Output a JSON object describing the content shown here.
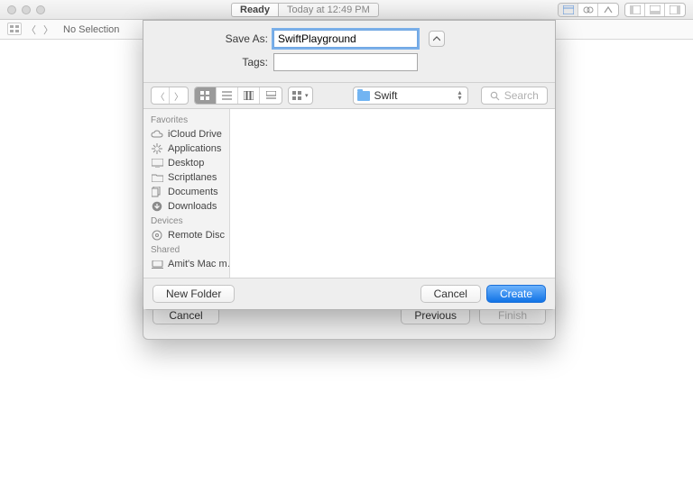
{
  "toolbar": {
    "status_label": "Ready",
    "time_label": "Today at 12:49 PM"
  },
  "subbar": {
    "selection_label": "No Selection"
  },
  "save_dialog": {
    "save_as_label": "Save As:",
    "save_as_value": "SwiftPlayground",
    "tags_label": "Tags:",
    "tags_value": "",
    "current_folder": "Swift",
    "search_placeholder": "Search",
    "new_folder_label": "New Folder",
    "cancel_label": "Cancel",
    "create_label": "Create"
  },
  "sidebar": {
    "favorites_label": "Favorites",
    "favorites": [
      {
        "label": "iCloud Drive",
        "icon": "cloud"
      },
      {
        "label": "Applications",
        "icon": "apps"
      },
      {
        "label": "Desktop",
        "icon": "desktop"
      },
      {
        "label": "Scriptlanes",
        "icon": "folder"
      },
      {
        "label": "Documents",
        "icon": "docs"
      },
      {
        "label": "Downloads",
        "icon": "download"
      }
    ],
    "devices_label": "Devices",
    "devices": [
      {
        "label": "Remote Disc",
        "icon": "disc"
      }
    ],
    "shared_label": "Shared",
    "shared": [
      {
        "label": "Amit's Mac m…",
        "icon": "computer"
      }
    ]
  },
  "assistant": {
    "cancel_label": "Cancel",
    "previous_label": "Previous",
    "finish_label": "Finish"
  }
}
